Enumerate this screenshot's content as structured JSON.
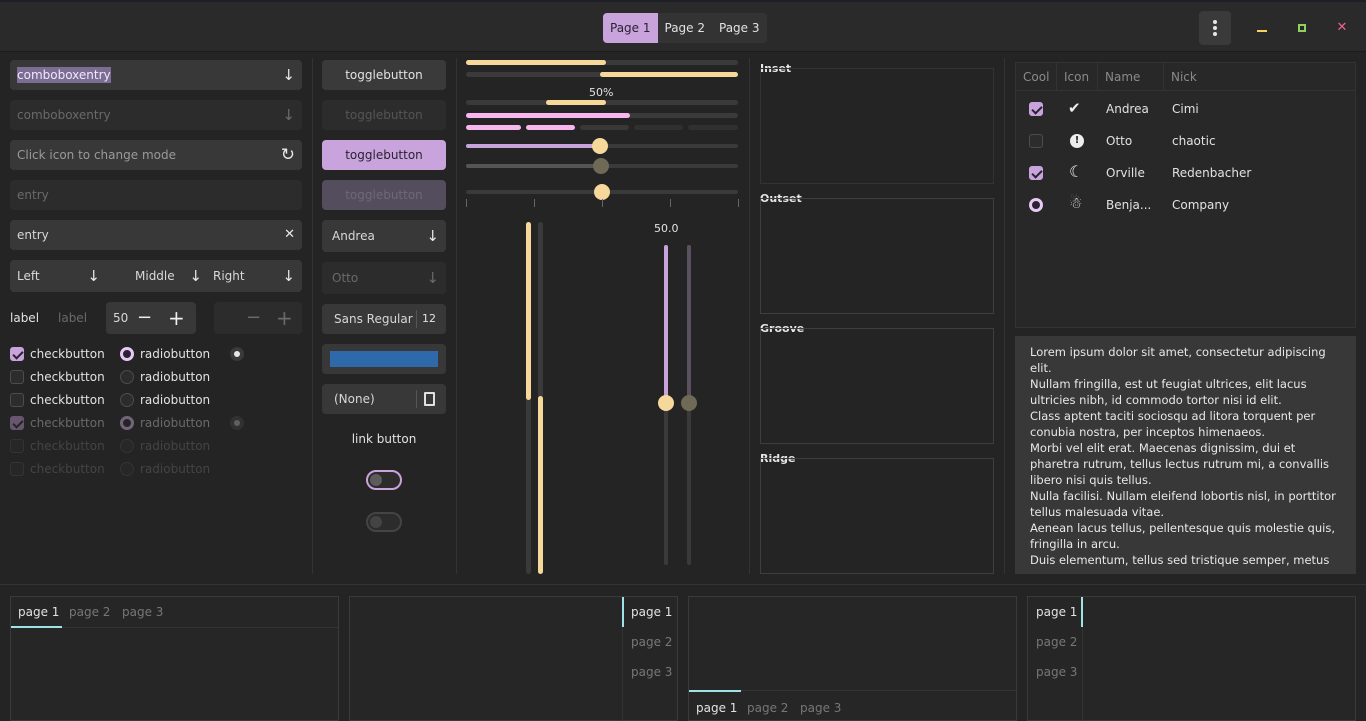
{
  "header": {
    "tabs": [
      "Page 1",
      "Page 2",
      "Page 3"
    ],
    "active_tab": 0,
    "close_glyph": "✕"
  },
  "col1": {
    "combo1": "comboboxentry",
    "combo2": "comboboxentry",
    "entry_icon_placeholder": "Click icon to change mode",
    "entry_disabled": "entry",
    "entry_clear": "entry",
    "close_glyph": "✕",
    "arrow_glyph": "↓",
    "refresh_glyph": "↻",
    "dropdowns": [
      "Left",
      "Middle",
      "Right"
    ],
    "label": "label",
    "label_disabled": "label",
    "spin_value": "50",
    "minus": "−",
    "plus": "+",
    "checks": [
      "checkbutton",
      "checkbutton",
      "checkbutton",
      "checkbutton",
      "checkbutton",
      "checkbutton"
    ],
    "radios": [
      "radiobutton",
      "radiobutton",
      "radiobutton",
      "radiobutton",
      "radiobutton",
      "radiobutton"
    ]
  },
  "col2": {
    "toggle1": "togglebutton",
    "toggle2": "togglebutton",
    "toggle3": "togglebutton",
    "toggle4": "togglebutton",
    "combo_andrea": "Andrea",
    "combo_otto": "Otto",
    "font_name": "Sans Regular",
    "font_size": "12",
    "color_hex": "#2e6aaa",
    "file_none": "(None)",
    "link": "link button"
  },
  "col3": {
    "progress_label": "50%",
    "scale_value": "50.0"
  },
  "frames": [
    "Inset",
    "Outset",
    "Groove",
    "Ridge"
  ],
  "tree": {
    "columns": [
      "Cool",
      "Icon",
      "Name",
      "Nick"
    ],
    "rows": [
      {
        "cool": "check",
        "icon": "✔",
        "name": "Andrea",
        "nick": "Cimi"
      },
      {
        "cool": "empty",
        "icon": "!",
        "name": "Otto",
        "nick": "chaotic"
      },
      {
        "cool": "check",
        "icon": "☾",
        "name": "Orville",
        "nick": "Redenbacher"
      },
      {
        "cool": "radio",
        "icon": "☃",
        "name": "Benja...",
        "nick": "Company"
      }
    ]
  },
  "textview": "Lorem ipsum dolor sit amet, consectetur adipiscing elit.\nNullam fringilla, est ut feugiat ultrices, elit lacus ultricies nibh, id commodo tortor nisi id elit.\nClass aptent taciti sociosqu ad litora torquent per conubia nostra, per inceptos himenaeos.\nMorbi vel elit erat. Maecenas dignissim, dui et pharetra rutrum, tellus lectus rutrum mi, a convallis libero nisi quis tellus.\nNulla facilisi. Nullam eleifend lobortis nisl, in porttitor tellus malesuada vitae.\nAenean lacus tellus, pellentesque quis molestie quis, fringilla in arcu.\nDuis elementum, tellus sed tristique semper, metus",
  "notebooks": {
    "tabs": [
      "page 1",
      "page 2",
      "page 3"
    ]
  },
  "colors": {
    "accent": "#c9a3dc",
    "scale": "#f6d99a",
    "level": "#f7b7ee",
    "tab_indicator": "#9fe3e6",
    "close": "#f2618a",
    "maximize": "#8fd35e",
    "minimize": "#f6d35e"
  }
}
